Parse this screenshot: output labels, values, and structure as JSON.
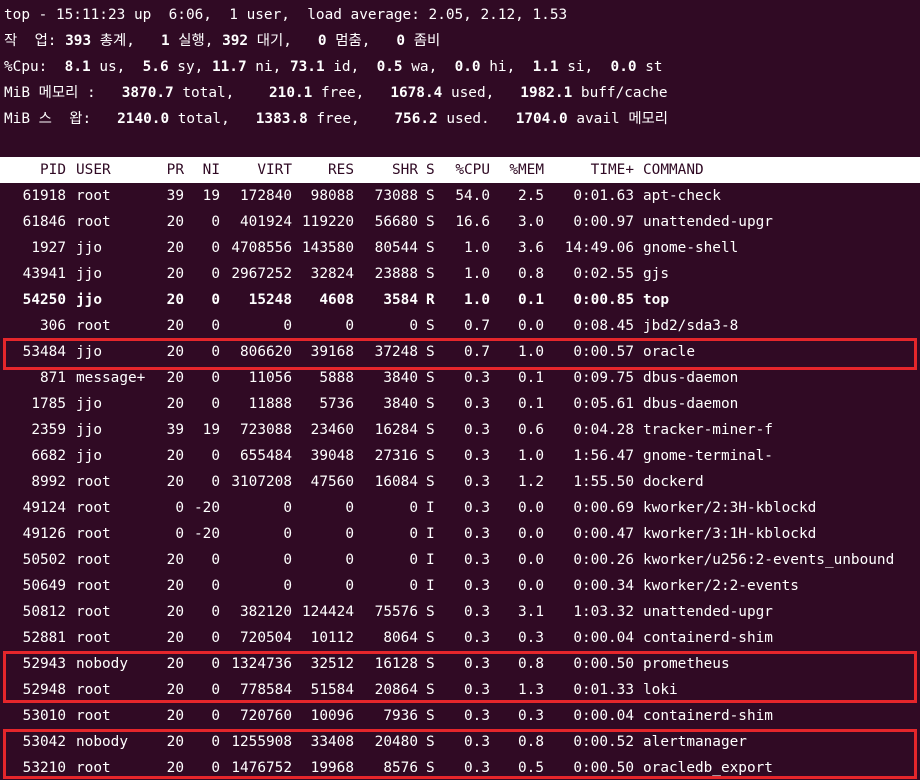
{
  "summary": {
    "line1": "top - 15:11:23 up  6:06,  1 user,  load average: 2.05, 2.12, 1.53",
    "line2": {
      "label": "작  업: ",
      "total": "393",
      "total_label": " 총계,   ",
      "running": "1",
      "running_label": " 실행, ",
      "sleeping": "392",
      "sleeping_label": " 대기,   ",
      "stopped": "0",
      "stopped_label": " 멈춤,   ",
      "zombie": "0",
      "zombie_label": " 좀비"
    },
    "cpu": {
      "label": "%Cpu:  ",
      "us": "8.1",
      "us_label": " us,  ",
      "sy": "5.6",
      "sy_label": " sy, ",
      "ni": "11.7",
      "ni_label": " ni, ",
      "id": "73.1",
      "id_label": " id,  ",
      "wa": "0.5",
      "wa_label": " wa,  ",
      "hi": "0.0",
      "hi_label": " hi,  ",
      "si": "1.1",
      "si_label": " si,  ",
      "st": "0.0",
      "st_label": " st"
    },
    "mem": {
      "label": "MiB 메모리 :   ",
      "total": "3870.7",
      "total_label": " total,    ",
      "free": "210.1",
      "free_label": " free,   ",
      "used": "1678.4",
      "used_label": " used,   ",
      "buff": "1982.1",
      "buff_label": " buff/cache"
    },
    "swap": {
      "label": "MiB 스  왑:   ",
      "total": "2140.0",
      "total_label": " total,   ",
      "free": "1383.8",
      "free_label": " free,    ",
      "used": "756.2",
      "used_label": " used.   ",
      "avail": "1704.0",
      "avail_label": " avail 메모리"
    }
  },
  "table": {
    "headers": {
      "pid": "PID",
      "user": "USER",
      "pr": "PR",
      "ni": "NI",
      "virt": "VIRT",
      "res": "RES",
      "shr": "SHR",
      "s": "S",
      "cpu": "%CPU",
      "mem": "%MEM",
      "time": "TIME+",
      "command": "COMMAND"
    },
    "rows": [
      {
        "pid": "61918",
        "user": "root",
        "pr": "39",
        "ni": "19",
        "virt": "172840",
        "res": "98088",
        "shr": "73088",
        "s": "S",
        "cpu": "54.0",
        "mem": "2.5",
        "time": "0:01.63",
        "command": "apt-check"
      },
      {
        "pid": "61846",
        "user": "root",
        "pr": "20",
        "ni": "0",
        "virt": "401924",
        "res": "119220",
        "shr": "56680",
        "s": "S",
        "cpu": "16.6",
        "mem": "3.0",
        "time": "0:00.97",
        "command": "unattended-upgr"
      },
      {
        "pid": "1927",
        "user": "jjo",
        "pr": "20",
        "ni": "0",
        "virt": "4708556",
        "res": "143580",
        "shr": "80544",
        "s": "S",
        "cpu": "1.0",
        "mem": "3.6",
        "time": "14:49.06",
        "command": "gnome-shell"
      },
      {
        "pid": "43941",
        "user": "jjo",
        "pr": "20",
        "ni": "0",
        "virt": "2967252",
        "res": "32824",
        "shr": "23888",
        "s": "S",
        "cpu": "1.0",
        "mem": "0.8",
        "time": "0:02.55",
        "command": "gjs"
      },
      {
        "pid": "54250",
        "user": "jjo",
        "pr": "20",
        "ni": "0",
        "virt": "15248",
        "res": "4608",
        "shr": "3584",
        "s": "R",
        "cpu": "1.0",
        "mem": "0.1",
        "time": "0:00.85",
        "command": "top",
        "bold": true
      },
      {
        "pid": "306",
        "user": "root",
        "pr": "20",
        "ni": "0",
        "virt": "0",
        "res": "0",
        "shr": "0",
        "s": "S",
        "cpu": "0.7",
        "mem": "0.0",
        "time": "0:08.45",
        "command": "jbd2/sda3-8"
      },
      {
        "pid": "53484",
        "user": "jjo",
        "pr": "20",
        "ni": "0",
        "virt": "806620",
        "res": "39168",
        "shr": "37248",
        "s": "S",
        "cpu": "0.7",
        "mem": "1.0",
        "time": "0:00.57",
        "command": "oracle"
      },
      {
        "pid": "871",
        "user": "message+",
        "pr": "20",
        "ni": "0",
        "virt": "11056",
        "res": "5888",
        "shr": "3840",
        "s": "S",
        "cpu": "0.3",
        "mem": "0.1",
        "time": "0:09.75",
        "command": "dbus-daemon"
      },
      {
        "pid": "1785",
        "user": "jjo",
        "pr": "20",
        "ni": "0",
        "virt": "11888",
        "res": "5736",
        "shr": "3840",
        "s": "S",
        "cpu": "0.3",
        "mem": "0.1",
        "time": "0:05.61",
        "command": "dbus-daemon"
      },
      {
        "pid": "2359",
        "user": "jjo",
        "pr": "39",
        "ni": "19",
        "virt": "723088",
        "res": "23460",
        "shr": "16284",
        "s": "S",
        "cpu": "0.3",
        "mem": "0.6",
        "time": "0:04.28",
        "command": "tracker-miner-f"
      },
      {
        "pid": "6682",
        "user": "jjo",
        "pr": "20",
        "ni": "0",
        "virt": "655484",
        "res": "39048",
        "shr": "27316",
        "s": "S",
        "cpu": "0.3",
        "mem": "1.0",
        "time": "1:56.47",
        "command": "gnome-terminal-"
      },
      {
        "pid": "8992",
        "user": "root",
        "pr": "20",
        "ni": "0",
        "virt": "3107208",
        "res": "47560",
        "shr": "16084",
        "s": "S",
        "cpu": "0.3",
        "mem": "1.2",
        "time": "1:55.50",
        "command": "dockerd"
      },
      {
        "pid": "49124",
        "user": "root",
        "pr": "0",
        "ni": "-20",
        "virt": "0",
        "res": "0",
        "shr": "0",
        "s": "I",
        "cpu": "0.3",
        "mem": "0.0",
        "time": "0:00.69",
        "command": "kworker/2:3H-kblockd"
      },
      {
        "pid": "49126",
        "user": "root",
        "pr": "0",
        "ni": "-20",
        "virt": "0",
        "res": "0",
        "shr": "0",
        "s": "I",
        "cpu": "0.3",
        "mem": "0.0",
        "time": "0:00.47",
        "command": "kworker/3:1H-kblockd"
      },
      {
        "pid": "50502",
        "user": "root",
        "pr": "20",
        "ni": "0",
        "virt": "0",
        "res": "0",
        "shr": "0",
        "s": "I",
        "cpu": "0.3",
        "mem": "0.0",
        "time": "0:00.26",
        "command": "kworker/u256:2-events_unbound"
      },
      {
        "pid": "50649",
        "user": "root",
        "pr": "20",
        "ni": "0",
        "virt": "0",
        "res": "0",
        "shr": "0",
        "s": "I",
        "cpu": "0.3",
        "mem": "0.0",
        "time": "0:00.34",
        "command": "kworker/2:2-events"
      },
      {
        "pid": "50812",
        "user": "root",
        "pr": "20",
        "ni": "0",
        "virt": "382120",
        "res": "124424",
        "shr": "75576",
        "s": "S",
        "cpu": "0.3",
        "mem": "3.1",
        "time": "1:03.32",
        "command": "unattended-upgr"
      },
      {
        "pid": "52881",
        "user": "root",
        "pr": "20",
        "ni": "0",
        "virt": "720504",
        "res": "10112",
        "shr": "8064",
        "s": "S",
        "cpu": "0.3",
        "mem": "0.3",
        "time": "0:00.04",
        "command": "containerd-shim"
      },
      {
        "pid": "52943",
        "user": "nobody",
        "pr": "20",
        "ni": "0",
        "virt": "1324736",
        "res": "32512",
        "shr": "16128",
        "s": "S",
        "cpu": "0.3",
        "mem": "0.8",
        "time": "0:00.50",
        "command": "prometheus"
      },
      {
        "pid": "52948",
        "user": "root",
        "pr": "20",
        "ni": "0",
        "virt": "778584",
        "res": "51584",
        "shr": "20864",
        "s": "S",
        "cpu": "0.3",
        "mem": "1.3",
        "time": "0:01.33",
        "command": "loki"
      },
      {
        "pid": "53010",
        "user": "root",
        "pr": "20",
        "ni": "0",
        "virt": "720760",
        "res": "10096",
        "shr": "7936",
        "s": "S",
        "cpu": "0.3",
        "mem": "0.3",
        "time": "0:00.04",
        "command": "containerd-shim"
      },
      {
        "pid": "53042",
        "user": "nobody",
        "pr": "20",
        "ni": "0",
        "virt": "1255908",
        "res": "33408",
        "shr": "20480",
        "s": "S",
        "cpu": "0.3",
        "mem": "0.8",
        "time": "0:00.52",
        "command": "alertmanager"
      },
      {
        "pid": "53210",
        "user": "root",
        "pr": "20",
        "ni": "0",
        "virt": "1476752",
        "res": "19968",
        "shr": "8576",
        "s": "S",
        "cpu": "0.3",
        "mem": "0.5",
        "time": "0:00.50",
        "command": "oracledb_export"
      }
    ]
  },
  "colors": {
    "background": "#300a24",
    "foreground": "#ffffff",
    "highlight_border": "#e5262b"
  }
}
